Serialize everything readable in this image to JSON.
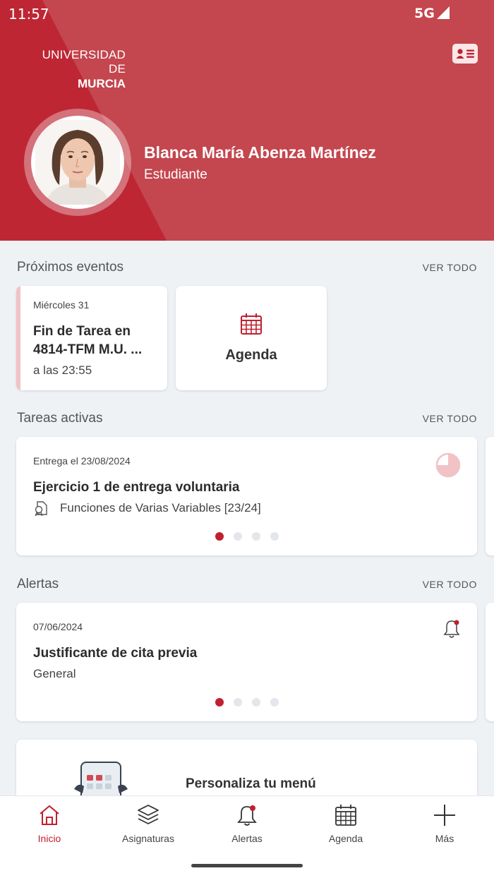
{
  "status_bar": {
    "time": "11:57",
    "network": "5G"
  },
  "header": {
    "logo_line1": "UNIVERSIDAD DE",
    "logo_line2": "MURCIA",
    "user_name": "Blanca María Abenza Martínez",
    "user_role": "Estudiante"
  },
  "events": {
    "title": "Próximos eventos",
    "see_all": "VER TODO",
    "item": {
      "day": "Miércoles 31",
      "title_line1": "Fin de Tarea en",
      "title_line2": "4814-TFM M.U. ...",
      "time": "a las 23:55"
    },
    "agenda_label": "Agenda"
  },
  "tasks": {
    "title": "Tareas activas",
    "see_all": "VER TODO",
    "item": {
      "due": "Entrega el 23/08/2024",
      "title": "Ejercicio 1 de entrega voluntaria",
      "subject": "Funciones de Varias Variables [23/24]"
    },
    "pages": 4,
    "current_page": 1
  },
  "alerts": {
    "title": "Alertas",
    "see_all": "VER TODO",
    "item": {
      "date": "07/06/2024",
      "title": "Justificante de cita previa",
      "category": "General"
    },
    "pages": 4,
    "current_page": 1
  },
  "promo": {
    "text": "Personaliza tu menú"
  },
  "nav": {
    "items": [
      {
        "label": "Inicio",
        "icon": "home-icon",
        "active": true
      },
      {
        "label": "Asignaturas",
        "icon": "layers-icon",
        "active": false
      },
      {
        "label": "Alertas",
        "icon": "bell-icon",
        "active": false
      },
      {
        "label": "Agenda",
        "icon": "calendar-icon",
        "active": false
      },
      {
        "label": "Más",
        "icon": "plus-icon",
        "active": false
      }
    ]
  },
  "colors": {
    "brand": "#be2634",
    "header_secondary": "#c4464e",
    "accent": "#c0202f",
    "background": "#eef2f5"
  }
}
